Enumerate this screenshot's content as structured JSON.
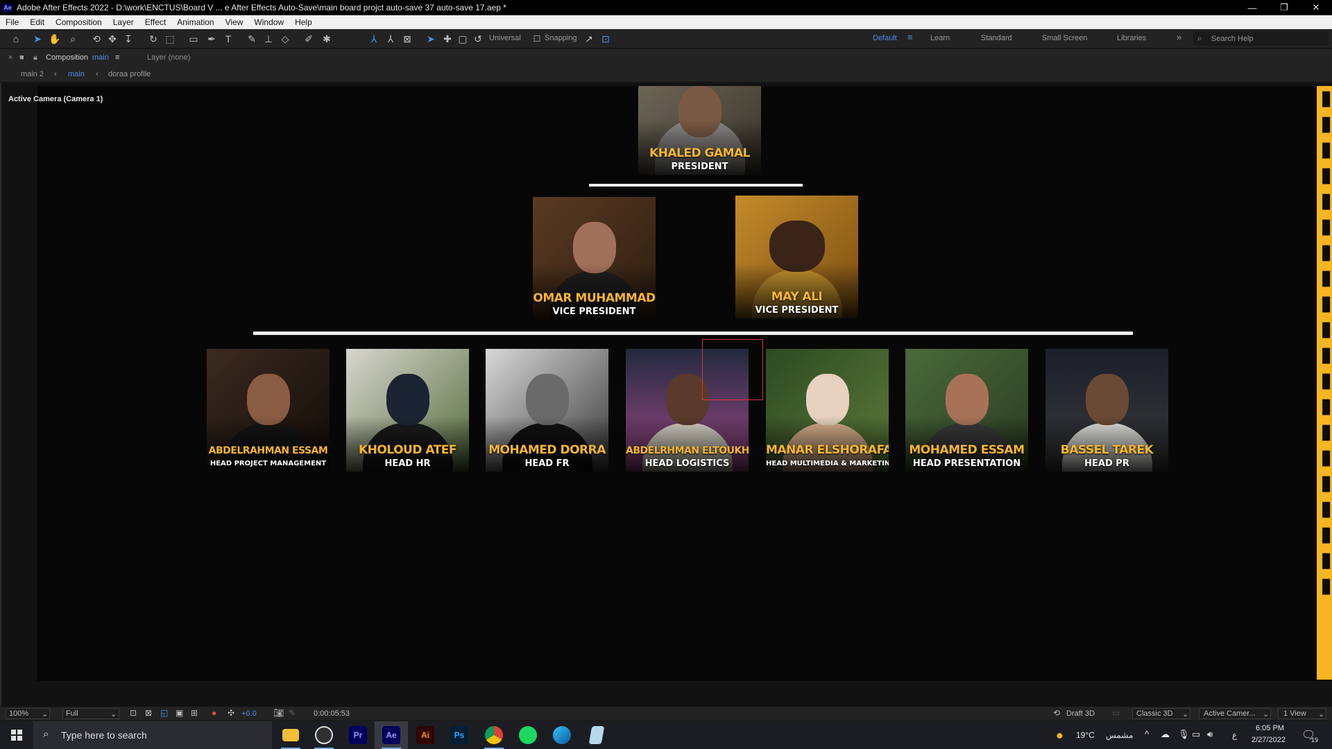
{
  "window": {
    "title": "Adobe After Effects 2022 - D:\\work\\ENCTUS\\Board V ... e After Effects Auto-Save\\main board projct auto-save 37 auto-save 17.aep *",
    "app_icon": "Ae",
    "minimize": "—",
    "restore": "❐",
    "close": "✕"
  },
  "menu": [
    "File",
    "Edit",
    "Composition",
    "Layer",
    "Effect",
    "Animation",
    "View",
    "Window",
    "Help"
  ],
  "toolbar": {
    "universal_label": "Universal",
    "snapping_label": "Snapping",
    "workspaces": [
      "Default",
      "Learn",
      "Standard",
      "Small Screen",
      "Libraries"
    ],
    "search_placeholder": "Search Help"
  },
  "panel": {
    "composition_label": "Composition",
    "composition_name": "main",
    "layer_label": "Layer (none)"
  },
  "breadcrumbs": [
    "main 2",
    "main",
    "doraa profile"
  ],
  "viewer": {
    "camera_label": "Active Camera (Camera 1)"
  },
  "board": {
    "president": {
      "name": "KHALED GAMAL",
      "role": "PRESIDENT"
    },
    "vice_presidents": [
      {
        "name": "OMAR MUHAMMAD",
        "role": "VICE PRESIDENT"
      },
      {
        "name": "MAY ALI",
        "role": "VICE PRESIDENT"
      }
    ],
    "heads": [
      {
        "name": "ABDELRAHMAN ESSAM",
        "role": "HEAD PROJECT MANAGEMENT"
      },
      {
        "name": "KHOLOUD ATEF",
        "role": "HEAD HR"
      },
      {
        "name": "MOHAMED DORRA",
        "role": "HEAD FR"
      },
      {
        "name": "ABDELRHMAN ELTOUKHY",
        "role": "HEAD LOGISTICS"
      },
      {
        "name": "MANAR ELSHORAFA",
        "role": "HEAD MULTIMEDIA & MARKETING"
      },
      {
        "name": "MOHAMED ESSAM",
        "role": "HEAD PRESENTATION"
      },
      {
        "name": "BASSEL TAREK",
        "role": "HEAD PR"
      }
    ]
  },
  "viewer_footer": {
    "zoom": "100%",
    "resolution": "Full",
    "exposure": "+0.0",
    "timecode": "0:00:05:53",
    "renderer_label": "Draft 3D",
    "renderer": "Classic 3D",
    "camera": "Active Camer...",
    "views": "1 View"
  },
  "taskbar": {
    "search_placeholder": "Type here to search",
    "apps": [
      {
        "name": "file-explorer",
        "label": ""
      },
      {
        "name": "obs",
        "label": ""
      },
      {
        "name": "premiere",
        "label": "Pr"
      },
      {
        "name": "after-effects",
        "label": "Ae"
      },
      {
        "name": "illustrator",
        "label": "Ai"
      },
      {
        "name": "photoshop",
        "label": "Ps"
      },
      {
        "name": "chrome",
        "label": ""
      },
      {
        "name": "spotify",
        "label": ""
      },
      {
        "name": "edge",
        "label": ""
      },
      {
        "name": "notes",
        "label": ""
      }
    ],
    "weather_temp": "19°C",
    "weather_text": "مشمس",
    "lang": "ع",
    "time": "6:05 PM",
    "date": "2/27/2022",
    "notification_count": "19"
  }
}
